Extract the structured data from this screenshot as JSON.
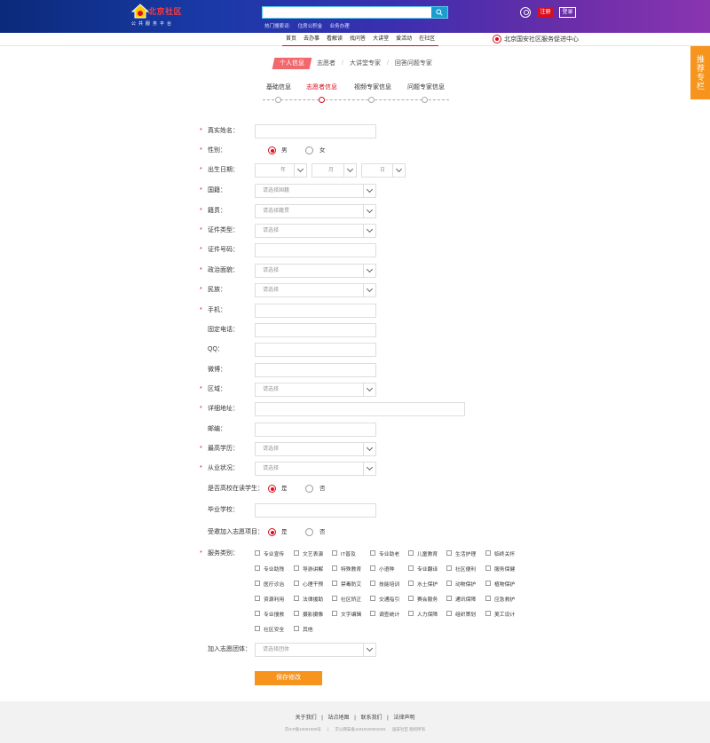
{
  "header": {
    "brand": "北京社区",
    "brand_sub": "公共服务平台",
    "search_placeholder": "",
    "hot_label": "热门搜索词:",
    "hot_words": [
      "住房公积金",
      "业务办理"
    ],
    "register_label": "注册",
    "login_label": "登录"
  },
  "nav": {
    "items": [
      "首页",
      "去办事",
      "看解读",
      "找问答",
      "大讲堂",
      "爱活动",
      "在社区"
    ],
    "org_name": "北京国安社区服务促进中心"
  },
  "side_tab": "推荐专栏",
  "type_tabs": [
    "个人信息",
    "志愿者",
    "大讲堂专家",
    "回答问题专家"
  ],
  "steps": [
    "基础信息",
    "志愿者信息",
    "视频专家信息",
    "问题专家信息"
  ],
  "form": {
    "real_name": "真实姓名：",
    "gender": "性别：",
    "gender_male": "男",
    "gender_female": "女",
    "birth": "出生日期：",
    "year": "年",
    "month": "月",
    "day": "日",
    "nationality": "国籍：",
    "nationality_ph": "请选择国籍",
    "native_place": "籍贯：",
    "native_place_ph": "请选择籍贯",
    "id_type": "证件类型：",
    "id_no": "证件号码：",
    "political": "政治面貌：",
    "ethnic": "民族：",
    "mobile": "手机：",
    "phone": "固定电话：",
    "qq": "QQ：",
    "weibo": "微博：",
    "area": "区域：",
    "address": "详细地址：",
    "zip": "邮编：",
    "education": "最高学历：",
    "employment": "从业状况：",
    "student": "是否高校在读学生：",
    "yes": "是",
    "no": "否",
    "school": "毕业学校：",
    "invited": "受邀加入志愿项目：",
    "service_type": "服务类别：",
    "join_group": "加入志愿团体：",
    "join_group_ph": "请选择团体",
    "select_ph": "请选择",
    "save_label": "保存修改"
  },
  "services": [
    "专业宣传",
    "文艺表演",
    "IT普及",
    "专业助老",
    "儿童教育",
    "生活护理",
    "临终关怀",
    "专业助残",
    "导游讲解",
    "特殊教育",
    "小语种",
    "专业翻译",
    "社区便利",
    "服务保健",
    "医疗诊治",
    "心理干预",
    "禁毒防艾",
    "技能培训",
    "水土保护",
    "动物保护",
    "植物保护",
    "资源利用",
    "法律援助",
    "社区矫正",
    "交通指引",
    "赛会服务",
    "通讯保障",
    "应急救护",
    "专业搜救",
    "摄影摄像",
    "文字编辑",
    "调查统计",
    "人力保障",
    "组织策划",
    "美工设计",
    "社区安全",
    "其他"
  ],
  "footer": {
    "links": [
      "关于我们",
      "站点地图",
      "联系我们",
      "法律声明"
    ],
    "separator": "|",
    "copy": [
      "京ICP备10001000号",
      "京公网安备11010100001001",
      "国安社区 版权所有"
    ]
  },
  "colors": {
    "accent": "#d80f1e",
    "orange": "#f7941d",
    "header_start": "#0b2a7a",
    "header_end": "#8a35b0"
  }
}
